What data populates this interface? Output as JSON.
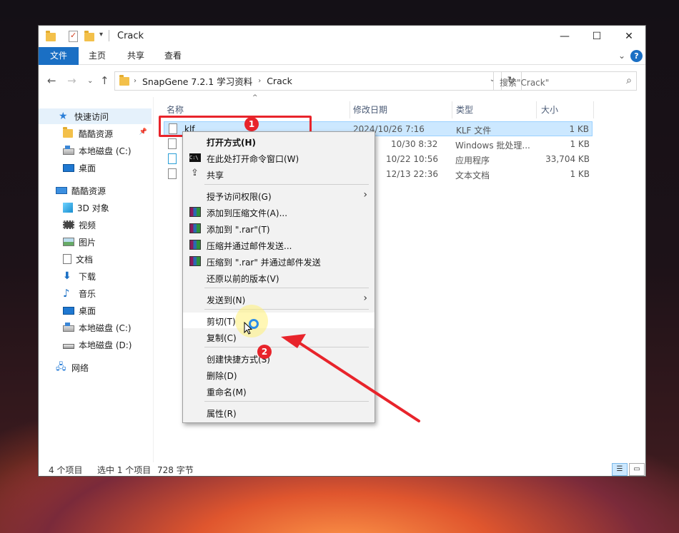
{
  "window": {
    "title": "Crack",
    "minimize_glyph": "—",
    "maximize_glyph": "☐",
    "close_glyph": "✕"
  },
  "ribbon": {
    "tabs": [
      "文件",
      "主页",
      "共享",
      "查看"
    ],
    "help": "?",
    "expand": "⌄"
  },
  "address": {
    "crumbs": [
      "SnapGene 7.2.1 学习资料",
      "Crack"
    ],
    "search_placeholder": "搜索\"Crack\""
  },
  "sidebar": {
    "items": [
      {
        "label": "快速访问",
        "icon": "star-icon"
      },
      {
        "label": "酷酷资源",
        "icon": "folder-icon"
      },
      {
        "label": "本地磁盘 (C:)",
        "icon": "drive-icon"
      },
      {
        "label": "桌面",
        "icon": "desktop-icon"
      },
      {
        "label": "酷酷资源",
        "icon": "computer-icon"
      },
      {
        "label": "3D 对象",
        "icon": "3d-objects-icon"
      },
      {
        "label": "视频",
        "icon": "video-icon"
      },
      {
        "label": "图片",
        "icon": "pictures-icon"
      },
      {
        "label": "文档",
        "icon": "documents-icon"
      },
      {
        "label": "下载",
        "icon": "downloads-icon"
      },
      {
        "label": "音乐",
        "icon": "music-icon"
      },
      {
        "label": "桌面",
        "icon": "desktop-icon"
      },
      {
        "label": "本地磁盘 (C:)",
        "icon": "drive-icon"
      },
      {
        "label": "本地磁盘 (D:)",
        "icon": "drive-icon"
      },
      {
        "label": "网络",
        "icon": "network-icon"
      }
    ]
  },
  "columns": {
    "name": "名称",
    "date": "修改日期",
    "type": "类型",
    "size": "大小"
  },
  "files": [
    {
      "name": "klf",
      "date": "2024/10/26 7:16",
      "type": "KLF 文件",
      "size": "1 KB"
    },
    {
      "name": "",
      "date": "10/30 8:32",
      "type": "Windows 批处理...",
      "size": "1 KB"
    },
    {
      "name": "",
      "date": "10/22 10:56",
      "type": "应用程序",
      "size": "33,704 KB"
    },
    {
      "name": "",
      "date": "12/13 22:36",
      "type": "文本文档",
      "size": "1 KB"
    }
  ],
  "status": {
    "count": "4 个项目",
    "selected": "选中 1 个项目",
    "size": "728 字节"
  },
  "context_menu": {
    "open_with": "打开方式(H)",
    "open_cmd": "在此处打开命令窗口(W)",
    "share": "共享",
    "grant_access": "授予访问权限(G)",
    "add_archive": "添加到压缩文件(A)...",
    "add_rar": "添加到 \".rar\"(T)",
    "compress_email": "压缩并通过邮件发送...",
    "compress_rar_email": "压缩到 \".rar\" 并通过邮件发送",
    "restore": "还原以前的版本(V)",
    "send_to": "发送到(N)",
    "cut": "剪切(T)",
    "copy": "复制(C)",
    "shortcut": "创建快捷方式(S)",
    "delete": "删除(D)",
    "rename": "重命名(M)",
    "properties": "属性(R)"
  },
  "annotations": {
    "step1": "1",
    "step2": "2",
    "annotation_color": "#e8242b"
  }
}
